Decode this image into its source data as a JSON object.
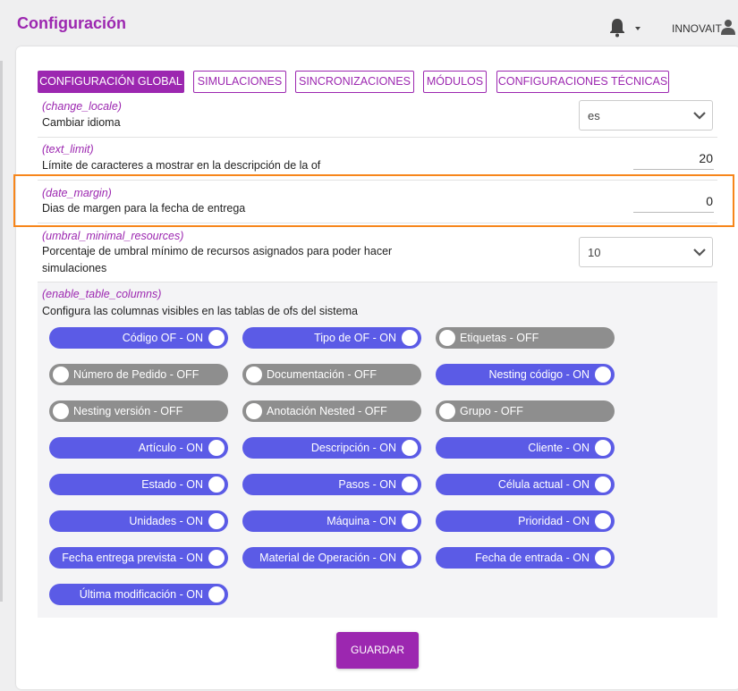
{
  "header": {
    "title": "Configuración",
    "user_name": "INNOVAIT",
    "icons": [
      "bell-icon",
      "chevron-down-icon",
      "user-icon"
    ]
  },
  "tabs": [
    {
      "label": "CONFIGURACIÓN GLOBAL",
      "active": true
    },
    {
      "label": "SIMULACIONES",
      "active": false
    },
    {
      "label": "SINCRONIZACIONES",
      "active": false
    },
    {
      "label": "MÓDULOS",
      "active": false
    },
    {
      "label": "CONFIGURACIONES TÉCNICAS",
      "active": false
    }
  ],
  "settings": {
    "change_locale": {
      "key": "(change_locale)",
      "desc": "Cambiar idioma",
      "value": "es"
    },
    "text_limit": {
      "key": "(text_limit)",
      "desc": "Límite de caracteres a mostrar en la descripción de la of",
      "value": "20"
    },
    "date_margin": {
      "key": "(date_margin)",
      "desc": "Dias de margen para la fecha de entrega",
      "value": "0"
    },
    "umbral": {
      "key": "(umbral_minimal_resources)",
      "desc_line1": "Porcentaje de umbral mínimo de recursos asignados para poder hacer",
      "desc_line2": "simulaciones",
      "value": "10"
    },
    "table_columns": {
      "key": "(enable_table_columns)",
      "desc": "Configura las columnas visibles en las tablas de ofs del sistema"
    }
  },
  "columns": [
    {
      "label": "Código OF - ON",
      "on": true
    },
    {
      "label": "Tipo de OF - ON",
      "on": true
    },
    {
      "label": "Etiquetas - OFF",
      "on": false
    },
    {
      "label": "Número de Pedido - OFF",
      "on": false
    },
    {
      "label": "Documentación - OFF",
      "on": false
    },
    {
      "label": "Nesting código - ON",
      "on": true
    },
    {
      "label": "Nesting versión - OFF",
      "on": false
    },
    {
      "label": "Anotación Nested - OFF",
      "on": false
    },
    {
      "label": "Grupo - OFF",
      "on": false
    },
    {
      "label": "Artículo - ON",
      "on": true
    },
    {
      "label": "Descripción - ON",
      "on": true
    },
    {
      "label": "Cliente - ON",
      "on": true
    },
    {
      "label": "Estado - ON",
      "on": true
    },
    {
      "label": "Pasos - ON",
      "on": true
    },
    {
      "label": "Célula actual - ON",
      "on": true
    },
    {
      "label": "Unidades - ON",
      "on": true
    },
    {
      "label": "Máquina - ON",
      "on": true
    },
    {
      "label": "Prioridad - ON",
      "on": true
    },
    {
      "label": "Fecha entrega prevista - ON",
      "on": true
    },
    {
      "label": "Material de Operación - ON",
      "on": true
    },
    {
      "label": "Fecha de entrada - ON",
      "on": true
    },
    {
      "label": "Última modificación - ON",
      "on": true
    }
  ],
  "save_label": "GUARDAR",
  "colors": {
    "accent": "#9c27b0",
    "toggle_on": "#5b5be6",
    "toggle_off": "#8e8e8e",
    "highlight": "#f7861b"
  }
}
